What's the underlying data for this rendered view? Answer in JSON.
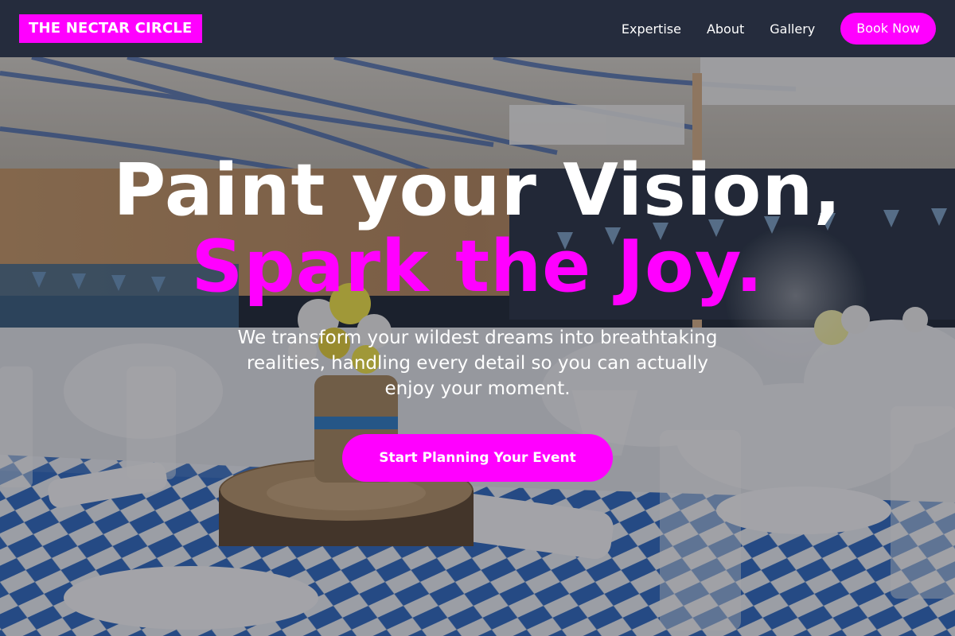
{
  "nav": {
    "brand": "THE NECTAR CIRCLE",
    "links": [
      "Expertise",
      "About",
      "Gallery"
    ],
    "book_label": "Book Now"
  },
  "hero": {
    "headline_line1": "Paint your Vision,",
    "headline_line2": "Spark the Joy.",
    "subtext": "We transform your wildest dreams into breathtaking realities, handling every detail so you can actually enjoy your moment.",
    "cta_label": "Start Planning Your Event",
    "background_image": "decorated-banquet-hall-icon"
  },
  "colors": {
    "accent": "#ff00ff",
    "nav_bg": "#252c3d",
    "text": "#ffffff"
  }
}
